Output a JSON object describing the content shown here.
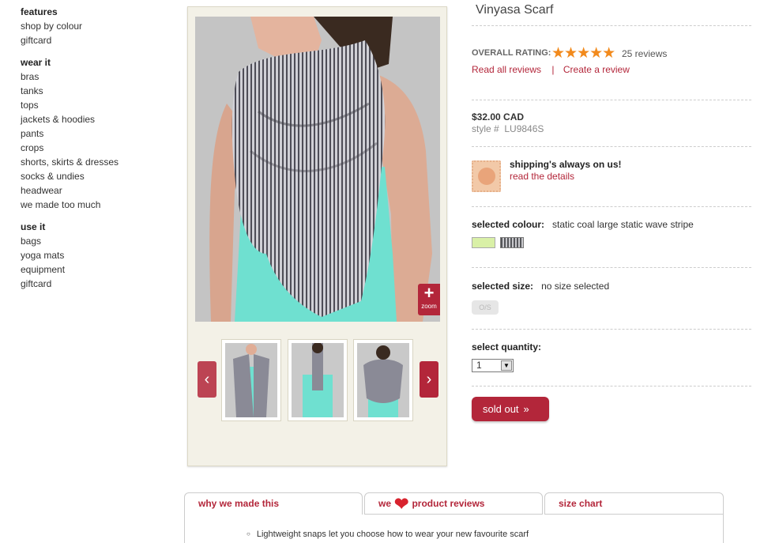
{
  "sidebar": {
    "groups": [
      {
        "heading": "features",
        "items": [
          "shop by colour",
          "giftcard"
        ]
      },
      {
        "heading": "wear it",
        "items": [
          "bras",
          "tanks",
          "tops",
          "jackets & hoodies",
          "pants",
          "crops",
          "shorts, skirts & dresses",
          "socks & undies",
          "headwear",
          "we made too much"
        ]
      },
      {
        "heading": "use it",
        "items": [
          "bags",
          "yoga mats",
          "equipment",
          "giftcard"
        ]
      }
    ]
  },
  "gallery": {
    "zoom_label": "zoom",
    "zoom_plus": "+",
    "prev_arrow": "‹",
    "next_arrow": "›"
  },
  "product": {
    "title": "Vinyasa Scarf",
    "rating_label": "OVERALL RATING:",
    "stars": "★★★★★",
    "reviews_count": "25 reviews",
    "read_reviews": "Read all reviews",
    "separator": "|",
    "create_review": "Create a review",
    "price": "$32.00 CAD",
    "style_label": "style #",
    "style_number": "LU9846S",
    "shipping_title": "shipping's always on us!",
    "shipping_link": "read the details",
    "colour_label": "selected colour:",
    "colour_value": "static coal large static wave stripe",
    "size_label": "selected size:",
    "size_value": "no size selected",
    "size_option": "O/S",
    "quantity_label": "select quantity:",
    "quantity_value": "1",
    "sold_out_label": "sold out",
    "sold_out_chevron": "»"
  },
  "tabs": {
    "tab1": "why we made this",
    "tab2_pre": "we",
    "tab2_post": "product reviews",
    "tab3": "size chart",
    "bullet1": "Lightweight snaps let you choose how to wear your new favourite scarf"
  },
  "colors": {
    "accent": "#b3263a",
    "star": "#f28a1c",
    "swatch_lime": "#d9f0a7"
  }
}
